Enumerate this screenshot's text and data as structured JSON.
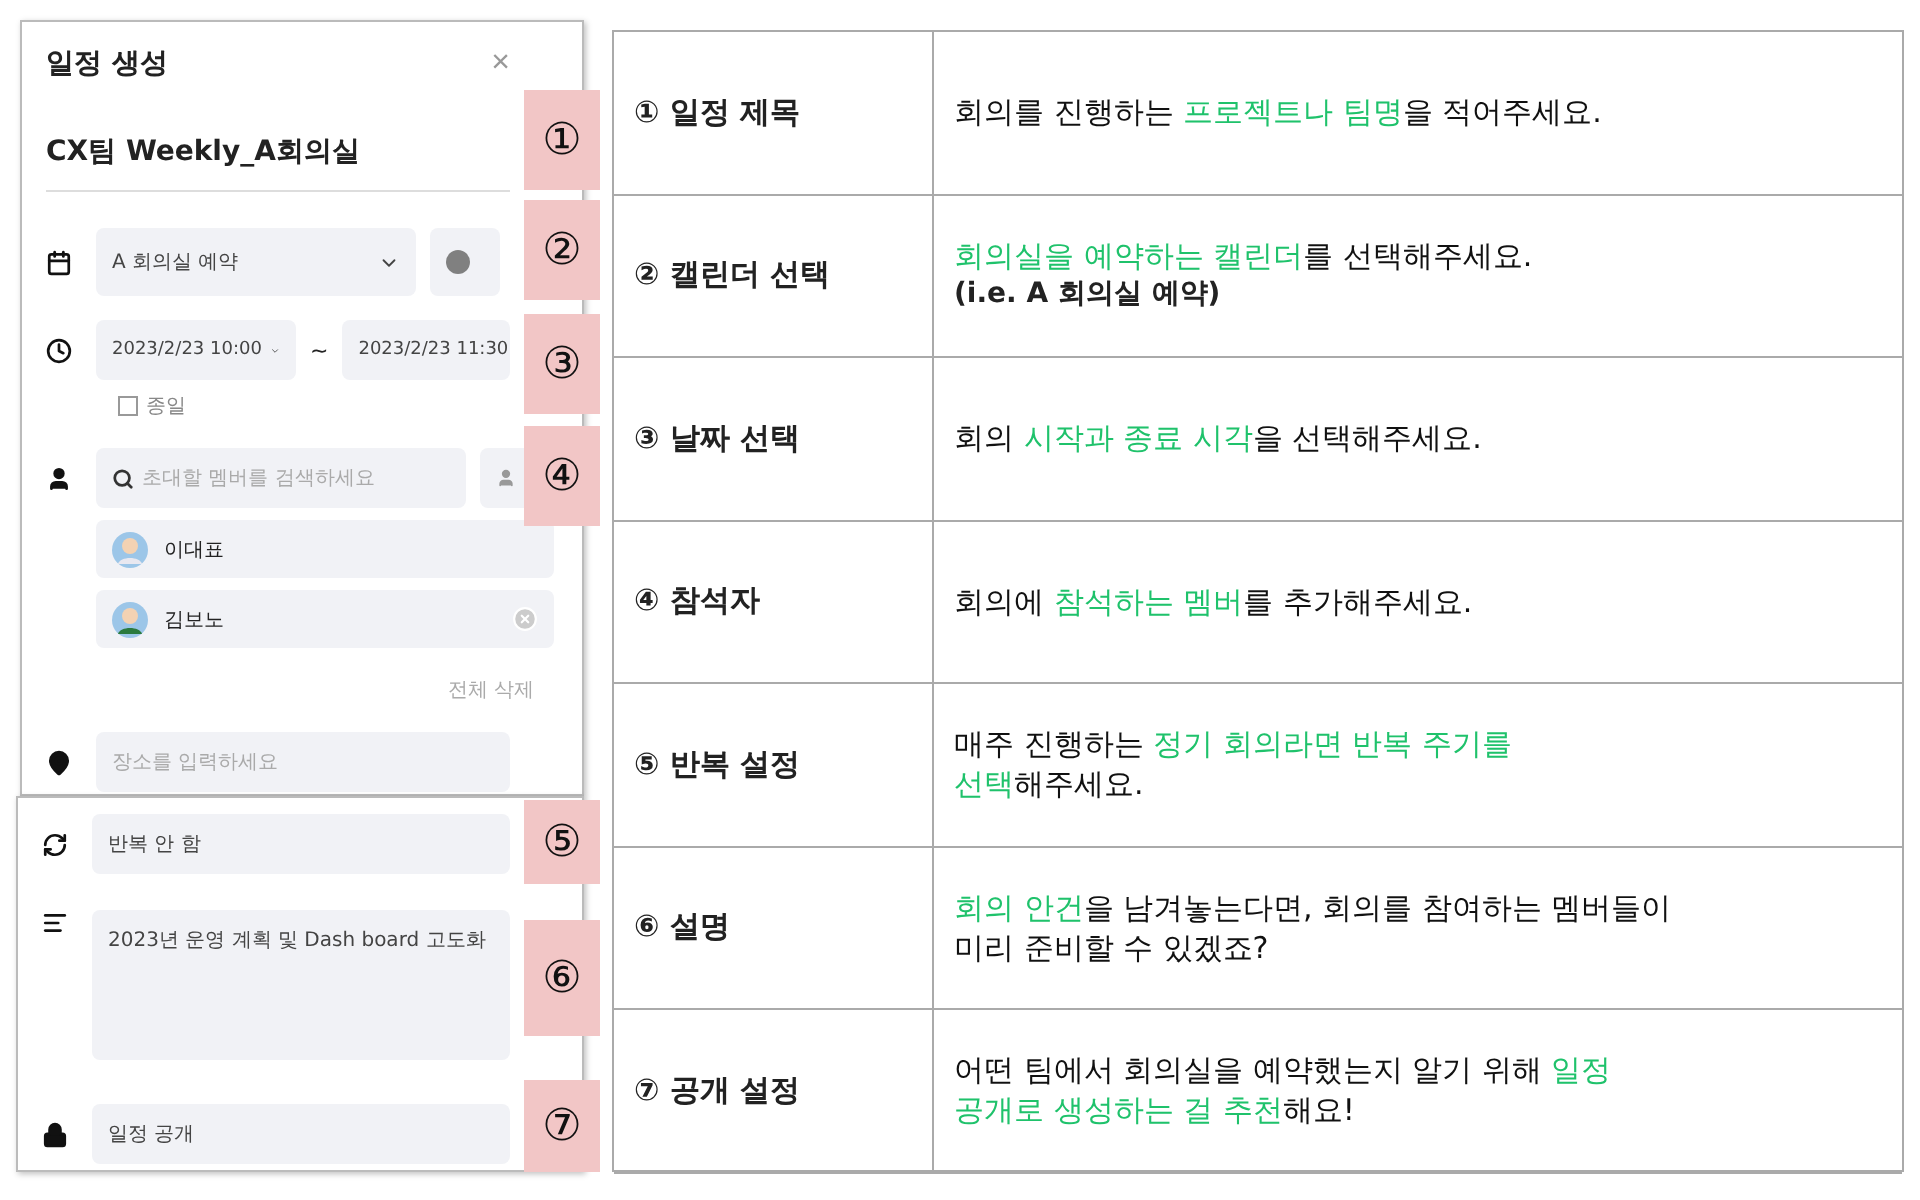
{
  "dialog": {
    "title": "일정 생성",
    "close": "×",
    "event_title": "CX팀 Weekly_A회의실",
    "calendar": "A 회의실 예약",
    "start": "2023/2/23 10:00",
    "separator": "~",
    "end": "2023/2/23 11:30",
    "all_day": {
      "label": "종일",
      "checked": false
    },
    "attendee_search": {
      "placeholder": "초대할 멤버를 검색하세요"
    },
    "attendees": [
      {
        "name": "이대표",
        "removable": false
      },
      {
        "name": "김보노",
        "removable": true
      }
    ],
    "clear_all": "전체 삭제",
    "location": {
      "placeholder": "장소를 입력하세요"
    },
    "repeat": "반복 안 함",
    "description": "2023년 운영 계획 및 Dash board 고도화",
    "visibility": "일정 공개"
  },
  "markers": [
    "①",
    "②",
    "③",
    "④",
    "⑤",
    "⑥",
    "⑦"
  ],
  "guide": {
    "rows": [
      {
        "label": "① 일정 제목",
        "lines": [
          [
            {
              "text": "회의를 진행하는 ",
              "highlight": false
            },
            {
              "text": "프로젝트나 팀명",
              "highlight": true
            },
            {
              "text": "을 적어주세요.",
              "highlight": false
            }
          ]
        ]
      },
      {
        "label": "② 캘린더 선택",
        "lines": [
          [
            {
              "text": "회의실을 예약하는 캘린더",
              "highlight": true
            },
            {
              "text": "를 선택해주세요.",
              "highlight": false
            }
          ]
        ],
        "note": "(i.e. A 회의실 예약)"
      },
      {
        "label": "③ 날짜 선택",
        "lines": [
          [
            {
              "text": "회의 ",
              "highlight": false
            },
            {
              "text": "시작과 종료 시각",
              "highlight": true
            },
            {
              "text": "을 선택해주세요.",
              "highlight": false
            }
          ]
        ]
      },
      {
        "label": "④ 참석자",
        "lines": [
          [
            {
              "text": "회의에 ",
              "highlight": false
            },
            {
              "text": "참석하는 멤버",
              "highlight": true
            },
            {
              "text": "를 추가해주세요.",
              "highlight": false
            }
          ]
        ]
      },
      {
        "label": "⑤ 반복 설정",
        "lines": [
          [
            {
              "text": "매주 진행하는 ",
              "highlight": false
            },
            {
              "text": "정기 회의라면 반복 주기를",
              "highlight": true
            }
          ],
          [
            {
              "text": "선택",
              "highlight": true
            },
            {
              "text": "해주세요.",
              "highlight": false
            }
          ]
        ]
      },
      {
        "label": "⑥ 설명",
        "lines": [
          [
            {
              "text": "회의 안건",
              "highlight": true
            },
            {
              "text": "을 남겨놓는다면, 회의를 참여하는 멤버들이",
              "highlight": false
            }
          ],
          [
            {
              "text": "미리 준비할 수 있겠죠?",
              "highlight": false
            }
          ]
        ]
      },
      {
        "label": "⑦ 공개 설정",
        "lines": [
          [
            {
              "text": "어떤 팀에서 회의실을 예약했는지 알기 위해 ",
              "highlight": false
            },
            {
              "text": "일정",
              "highlight": true
            }
          ],
          [
            {
              "text": "공개로 생성하는 걸 추천",
              "highlight": true
            },
            {
              "text": "해요!",
              "highlight": false
            }
          ]
        ]
      }
    ]
  }
}
